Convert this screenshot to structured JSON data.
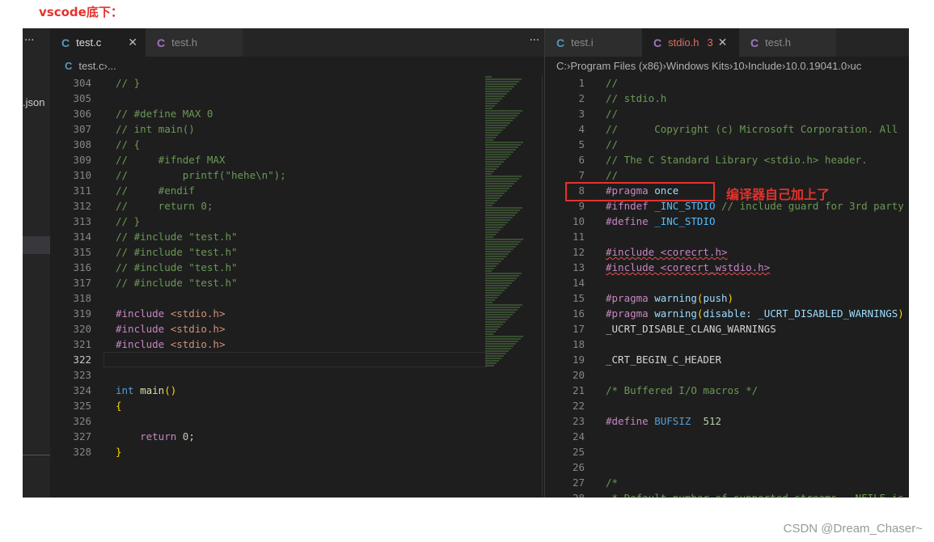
{
  "heading": "vscode底下：",
  "sidebar": {
    "more": "···",
    "file_fragment": ".json"
  },
  "left": {
    "tabs": [
      {
        "label": "test.c",
        "icon": "c-file-icon",
        "icon_letter": "C",
        "active": true,
        "close": "✕"
      },
      {
        "label": "test.h",
        "icon": "c-header-icon",
        "icon_letter": "C",
        "active": false
      }
    ],
    "more": "···",
    "breadcrumb": [
      "test.c",
      "..."
    ],
    "current_line": 322,
    "lines": [
      [
        304,
        [
          [
            "// }",
            "com"
          ]
        ]
      ],
      [
        305,
        []
      ],
      [
        306,
        [
          [
            "// #define MAX 0",
            "com"
          ]
        ]
      ],
      [
        307,
        [
          [
            "// int main()",
            "com"
          ]
        ]
      ],
      [
        308,
        [
          [
            "// {",
            "com"
          ]
        ]
      ],
      [
        309,
        [
          [
            "//     #ifndef MAX",
            "com"
          ]
        ]
      ],
      [
        310,
        [
          [
            "//         printf(\"hehe\\n\");",
            "com"
          ]
        ]
      ],
      [
        311,
        [
          [
            "//     #endif",
            "com"
          ]
        ]
      ],
      [
        312,
        [
          [
            "//     return 0;",
            "com"
          ]
        ]
      ],
      [
        313,
        [
          [
            "// }",
            "com"
          ]
        ]
      ],
      [
        314,
        [
          [
            "// #include \"test.h\"",
            "com"
          ]
        ]
      ],
      [
        315,
        [
          [
            "// #include \"test.h\"",
            "com"
          ]
        ]
      ],
      [
        316,
        [
          [
            "// #include \"test.h\"",
            "com"
          ]
        ]
      ],
      [
        317,
        [
          [
            "// #include \"test.h\"",
            "com"
          ]
        ]
      ],
      [
        318,
        []
      ],
      [
        319,
        [
          [
            "#include ",
            "kw"
          ],
          [
            "<stdio.h>",
            "str"
          ]
        ]
      ],
      [
        320,
        [
          [
            "#include ",
            "kw"
          ],
          [
            "<stdio.h>",
            "str"
          ]
        ]
      ],
      [
        321,
        [
          [
            "#include ",
            "kw"
          ],
          [
            "<stdio.h>",
            "str"
          ]
        ]
      ],
      [
        322,
        []
      ],
      [
        323,
        []
      ],
      [
        324,
        [
          [
            "int ",
            "type"
          ],
          [
            "main",
            "fn"
          ],
          [
            "()",
            "br"
          ]
        ]
      ],
      [
        325,
        [
          [
            "{",
            "br"
          ]
        ]
      ],
      [
        326,
        []
      ],
      [
        327,
        [
          [
            "    return ",
            "kw"
          ],
          [
            "0",
            "num"
          ],
          [
            ";",
            "pl"
          ]
        ]
      ],
      [
        328,
        [
          [
            "}",
            "br"
          ]
        ]
      ]
    ]
  },
  "right": {
    "tabs": [
      {
        "label": "test.i",
        "icon": "c-file-icon",
        "icon_letter": "C",
        "active": false
      },
      {
        "label": "stdio.h",
        "icon": "c-header-icon",
        "icon_letter": "C",
        "active": true,
        "problems": "3",
        "close": "✕"
      },
      {
        "label": "test.h",
        "icon": "c-header-icon",
        "icon_letter": "C",
        "active": false
      }
    ],
    "breadcrumb": [
      "C:",
      "Program Files (x86)",
      "Windows Kits",
      "10",
      "Include",
      "10.0.19041.0",
      "uc"
    ],
    "lines": [
      [
        1,
        [
          [
            "//",
            "com"
          ]
        ]
      ],
      [
        2,
        [
          [
            "// stdio.h",
            "com"
          ]
        ]
      ],
      [
        3,
        [
          [
            "//",
            "com"
          ]
        ]
      ],
      [
        4,
        [
          [
            "//      Copyright (c) Microsoft Corporation. All",
            "com"
          ]
        ]
      ],
      [
        5,
        [
          [
            "//",
            "com"
          ]
        ]
      ],
      [
        6,
        [
          [
            "// The C Standard Library <stdio.h> header.",
            "com"
          ]
        ]
      ],
      [
        7,
        [
          [
            "//",
            "com"
          ]
        ]
      ],
      [
        8,
        [
          [
            "#pragma ",
            "kw"
          ],
          [
            "once",
            "var"
          ]
        ]
      ],
      [
        9,
        [
          [
            "#ifndef ",
            "kw"
          ],
          [
            "_INC_STDIO",
            "mac"
          ],
          [
            " // include guard for 3rd party",
            "com"
          ]
        ]
      ],
      [
        10,
        [
          [
            "#define ",
            "kw"
          ],
          [
            "_INC_STDIO",
            "mac"
          ]
        ]
      ],
      [
        11,
        []
      ],
      [
        12,
        [
          [
            "#include <corecrt.h>",
            "squig"
          ]
        ]
      ],
      [
        13,
        [
          [
            "#include <corecrt_wstdio.h>",
            "squig"
          ]
        ]
      ],
      [
        14,
        []
      ],
      [
        15,
        [
          [
            "#pragma ",
            "kw"
          ],
          [
            "warning",
            "var"
          ],
          [
            "(",
            "br"
          ],
          [
            "push",
            "var"
          ],
          [
            ")",
            "br"
          ]
        ]
      ],
      [
        16,
        [
          [
            "#pragma ",
            "kw"
          ],
          [
            "warning",
            "var"
          ],
          [
            "(",
            "br"
          ],
          [
            "disable: _UCRT_DISABLED_WARNINGS",
            "var"
          ],
          [
            ")",
            "br"
          ]
        ]
      ],
      [
        17,
        [
          [
            "_UCRT_DISABLE_CLANG_WARNINGS",
            "pl"
          ]
        ]
      ],
      [
        18,
        []
      ],
      [
        19,
        [
          [
            "_CRT_BEGIN_C_HEADER",
            "pl"
          ]
        ]
      ],
      [
        20,
        []
      ],
      [
        21,
        [
          [
            "/* Buffered I/O macros */",
            "com"
          ]
        ]
      ],
      [
        22,
        []
      ],
      [
        23,
        [
          [
            "#define ",
            "kw"
          ],
          [
            "BUFSIZ",
            "type"
          ],
          [
            "  ",
            "pl"
          ],
          [
            "512",
            "num"
          ]
        ]
      ],
      [
        24,
        []
      ],
      [
        25,
        []
      ],
      [
        26,
        []
      ],
      [
        27,
        [
          [
            "/*",
            "com"
          ]
        ]
      ],
      [
        28,
        [
          [
            " * Default number of supported streams. _NFILE is",
            "com"
          ]
        ]
      ]
    ],
    "annotation": "编译器自己加上了"
  },
  "watermark": "CSDN @Dream_Chaser~"
}
